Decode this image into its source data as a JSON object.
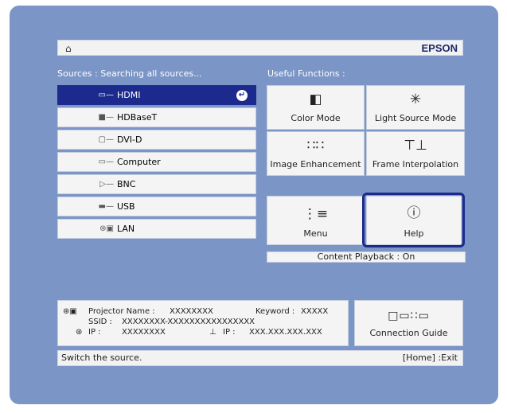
{
  "header": {
    "home_icon": "home-icon",
    "brand": "EPSON"
  },
  "sources": {
    "heading": "Sources :  Searching all sources...",
    "items": [
      {
        "label": "HDMI",
        "icon": "hdmi-cable-icon",
        "selected": true
      },
      {
        "label": "HDBaseT",
        "icon": "hdbaset-cable-icon",
        "selected": false
      },
      {
        "label": "DVI-D",
        "icon": "dvi-cable-icon",
        "selected": false
      },
      {
        "label": "Computer",
        "icon": "vga-cable-icon",
        "selected": false
      },
      {
        "label": "BNC",
        "icon": "bnc-cable-icon",
        "selected": false
      },
      {
        "label": "USB",
        "icon": "usb-cable-icon",
        "selected": false
      },
      {
        "label": "LAN",
        "icon": "lan-icon",
        "selected": false
      }
    ]
  },
  "functions": {
    "heading": "Useful Functions :",
    "tiles": [
      {
        "label": "Color Mode",
        "icon": "color-mode-icon"
      },
      {
        "label": "Light Source Mode",
        "icon": "light-source-icon"
      },
      {
        "label": "Image Enhancement",
        "icon": "image-enhancement-icon"
      },
      {
        "label": "Frame Interpolation",
        "icon": "frame-interpolation-icon"
      },
      {
        "label": "Menu",
        "icon": "menu-icon"
      },
      {
        "label": "Help",
        "icon": "help-icon"
      }
    ],
    "playback": "Content Playback : On"
  },
  "network": {
    "projector_name_label": "Projector Name :",
    "projector_name_value": "XXXXXXXX",
    "keyword_label": "Keyword :",
    "keyword_value": "XXXXX",
    "ssid_label": "SSID  :",
    "ssid_value": "XXXXXXXX-XXXXXXXXXXXXXXXX",
    "wireless_ip_label": "IP  :",
    "wireless_ip_value": "XXXXXXXX",
    "wired_ip_label": "IP :",
    "wired_ip_value": "XXX.XXX.XXX.XXX"
  },
  "connection_guide": {
    "label": "Connection Guide",
    "icon": "connection-guide-icon"
  },
  "footer": {
    "hint": "Switch the source.",
    "exit": "[Home] :Exit"
  }
}
